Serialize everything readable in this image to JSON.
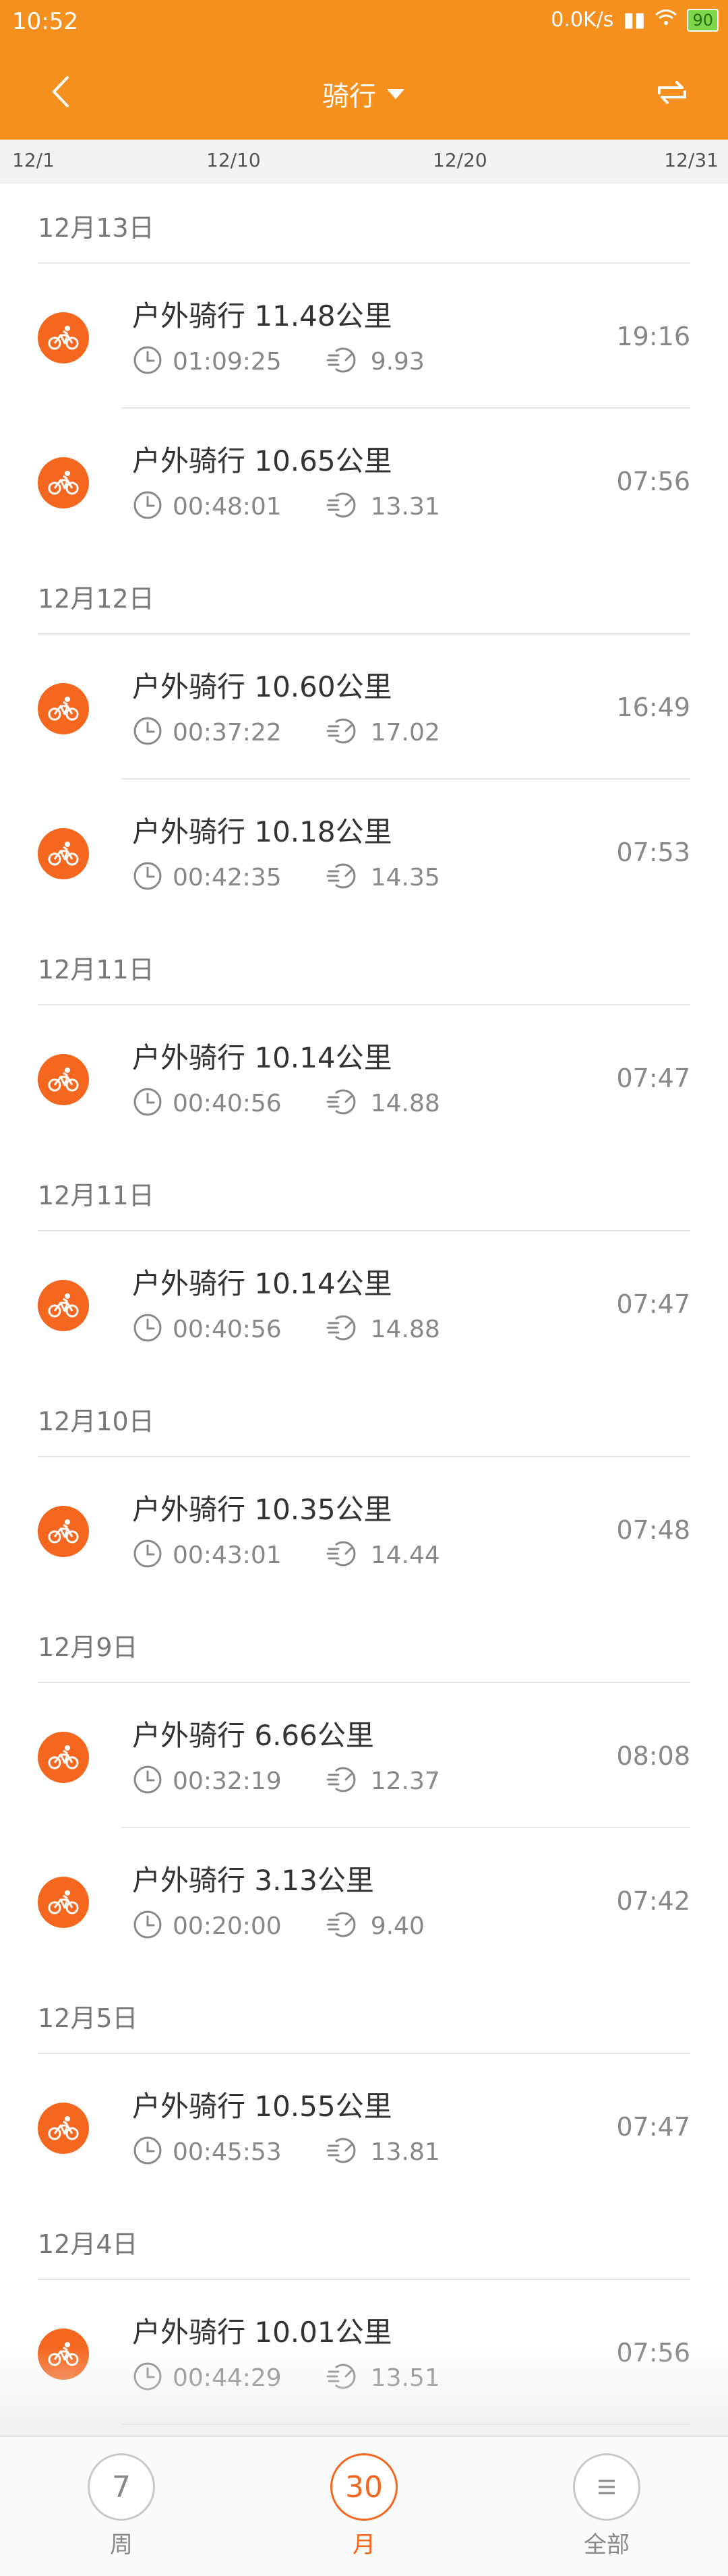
{
  "status_bar": {
    "time": "10:52",
    "net_speed": "0.0K/s",
    "battery": "90"
  },
  "nav": {
    "title": "骑行"
  },
  "scale": [
    "12/1",
    "12/10",
    "12/20",
    "12/31"
  ],
  "groups": [
    {
      "date": "12月13日",
      "records": [
        {
          "title": "户外骑行 11.48公里",
          "duration": "01:09:25",
          "speed": "9.93",
          "time": "19:16"
        },
        {
          "title": "户外骑行 10.65公里",
          "duration": "00:48:01",
          "speed": "13.31",
          "time": "07:56"
        }
      ]
    },
    {
      "date": "12月12日",
      "records": [
        {
          "title": "户外骑行 10.60公里",
          "duration": "00:37:22",
          "speed": "17.02",
          "time": "16:49"
        },
        {
          "title": "户外骑行 10.18公里",
          "duration": "00:42:35",
          "speed": "14.35",
          "time": "07:53"
        }
      ]
    },
    {
      "date": "12月11日",
      "records": [
        {
          "title": "户外骑行 10.14公里",
          "duration": "00:40:56",
          "speed": "14.88",
          "time": "07:47"
        }
      ]
    },
    {
      "date": "12月11日",
      "records": [
        {
          "title": "户外骑行 10.14公里",
          "duration": "00:40:56",
          "speed": "14.88",
          "time": "07:47"
        }
      ]
    },
    {
      "date": "12月10日",
      "records": [
        {
          "title": "户外骑行 10.35公里",
          "duration": "00:43:01",
          "speed": "14.44",
          "time": "07:48"
        }
      ]
    },
    {
      "date": "12月9日",
      "records": [
        {
          "title": "户外骑行 6.66公里",
          "duration": "00:32:19",
          "speed": "12.37",
          "time": "08:08"
        },
        {
          "title": "户外骑行 3.13公里",
          "duration": "00:20:00",
          "speed": "9.40",
          "time": "07:42"
        }
      ]
    },
    {
      "date": "12月5日",
      "records": [
        {
          "title": "户外骑行 10.55公里",
          "duration": "00:45:53",
          "speed": "13.81",
          "time": "07:47"
        }
      ]
    },
    {
      "date": "12月4日",
      "records": [
        {
          "title": "户外骑行 10.01公里",
          "duration": "00:44:29",
          "speed": "13.51",
          "time": "07:56"
        }
      ]
    }
  ],
  "tabs": [
    {
      "num": "7",
      "label": "周",
      "active": false
    },
    {
      "num": "30",
      "label": "月",
      "active": true
    },
    {
      "num": "",
      "label": "全部",
      "active": false
    }
  ],
  "colors": {
    "accent": "#f5901e",
    "icon_bg": "#f5671f"
  }
}
